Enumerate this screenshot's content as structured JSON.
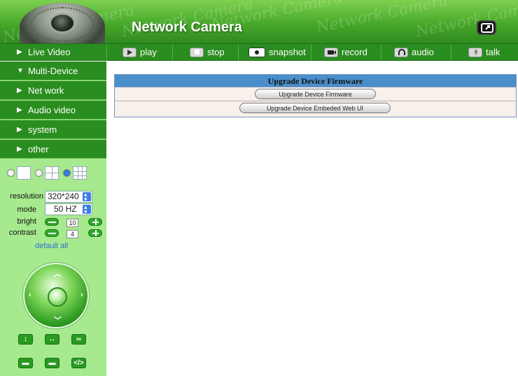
{
  "header": {
    "title": "Network Camera",
    "watermark": "Network Camera",
    "fullscreen_icon": "fullscreen-icon"
  },
  "toolbar": {
    "live_video": "Live Video",
    "tools": [
      {
        "label": "play",
        "icon": "play-icon"
      },
      {
        "label": "stop",
        "icon": "stop-icon"
      },
      {
        "label": "snapshot",
        "icon": "snapshot-icon"
      },
      {
        "label": "record",
        "icon": "record-icon"
      },
      {
        "label": "audio",
        "icon": "audio-icon"
      },
      {
        "label": "talk",
        "icon": "talk-icon"
      }
    ]
  },
  "sidebar": {
    "menu": [
      {
        "label": "Multi-Device",
        "expanded": true
      },
      {
        "label": "Net work",
        "expanded": false
      },
      {
        "label": "Audio video",
        "expanded": false
      },
      {
        "label": "system",
        "expanded": false
      },
      {
        "label": "other",
        "expanded": false
      }
    ],
    "layout_selected": "nine-split",
    "controls": {
      "resolution_label": "resolution",
      "resolution_value": "320*240",
      "mode_label": "mode",
      "mode_value": "50 HZ",
      "bright_label": "bright",
      "bright_value": "10",
      "contrast_label": "contrast",
      "contrast_value": "4",
      "default_all": "default all"
    }
  },
  "main": {
    "panel_title": "Upgrade Device Firmware",
    "buttons": {
      "upgrade_firmware": "Upgrade Device Firmware",
      "upgrade_web_ui": "Upgrade Device Embeded Web UI"
    }
  },
  "colors": {
    "accent_green": "#2a8d1f",
    "sidebar_bg": "#a6e98f",
    "panel_header": "#4a8fcb",
    "panel_bg": "#f8f0ea"
  }
}
